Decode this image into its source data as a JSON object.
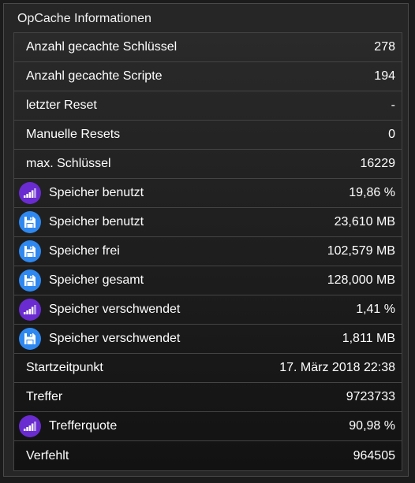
{
  "title": "OpCache Informationen",
  "colors": {
    "signal_icon": "#6a2bd0",
    "save_icon": "#2f88f0"
  },
  "rows": [
    {
      "label": "Anzahl gecachte Schlüssel",
      "value": "278",
      "icon": ""
    },
    {
      "label": "Anzahl gecachte Scripte",
      "value": "194",
      "icon": ""
    },
    {
      "label": "letzter Reset",
      "value": "-",
      "icon": ""
    },
    {
      "label": "Manuelle Resets",
      "value": "0",
      "icon": ""
    },
    {
      "label": "max. Schlüssel",
      "value": "16229",
      "icon": ""
    },
    {
      "label": "Speicher benutzt",
      "value": "19,86 %",
      "icon": "signal-icon"
    },
    {
      "label": "Speicher benutzt",
      "value": "23,610 MB",
      "icon": "save-icon"
    },
    {
      "label": "Speicher frei",
      "value": "102,579 MB",
      "icon": "save-icon"
    },
    {
      "label": "Speicher gesamt",
      "value": "128,000 MB",
      "icon": "save-icon"
    },
    {
      "label": "Speicher verschwendet",
      "value": "1,41 %",
      "icon": "signal-icon"
    },
    {
      "label": "Speicher verschwendet",
      "value": "1,811 MB",
      "icon": "save-icon"
    },
    {
      "label": "Startzeitpunkt",
      "value": "17. März 2018 22:38",
      "icon": ""
    },
    {
      "label": "Treffer",
      "value": "9723733",
      "icon": ""
    },
    {
      "label": "Trefferquote",
      "value": "90,98 %",
      "icon": "signal-icon"
    },
    {
      "label": "Verfehlt",
      "value": "964505",
      "icon": ""
    }
  ]
}
